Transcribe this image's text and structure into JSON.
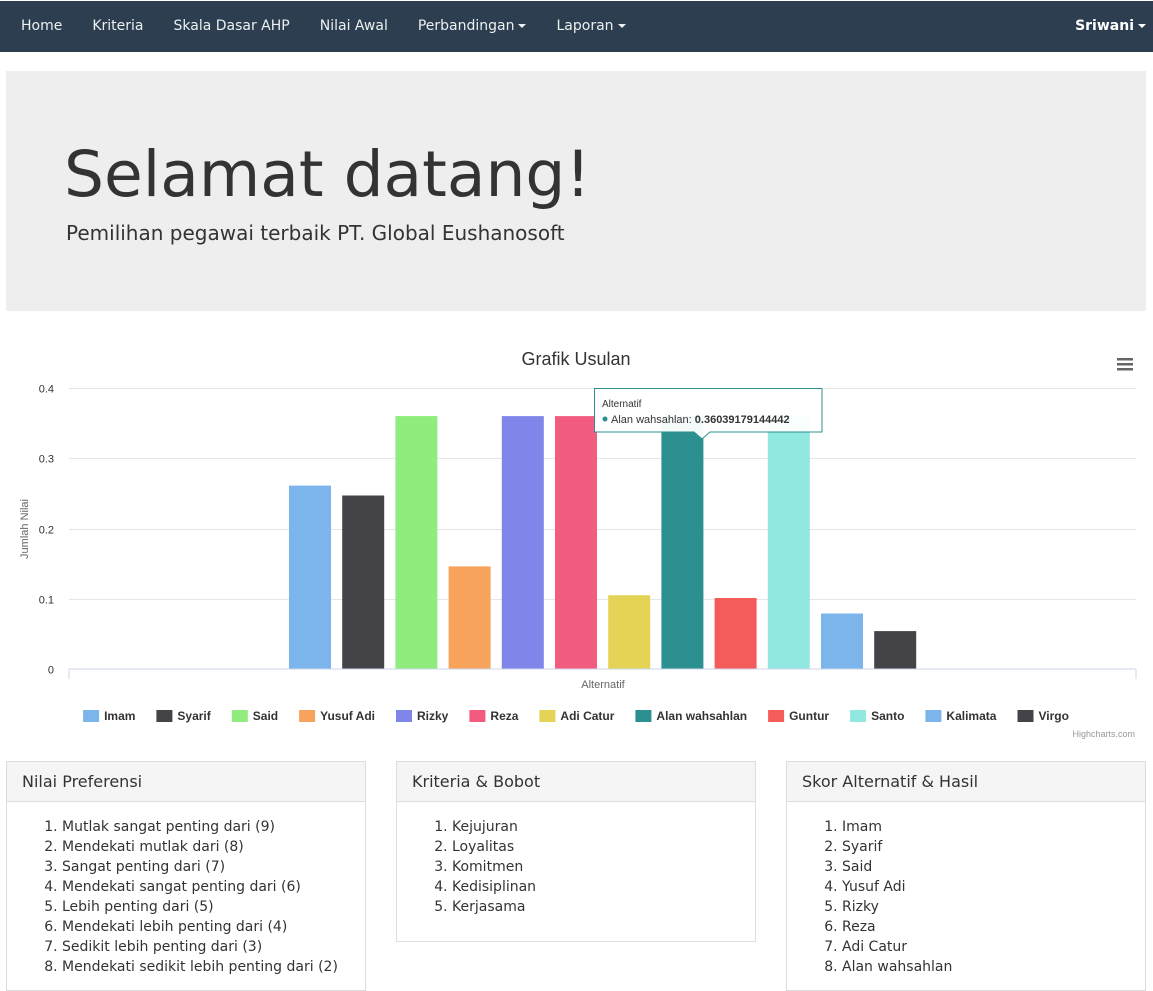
{
  "navbar": {
    "items": [
      {
        "label": "Home",
        "dropdown": false
      },
      {
        "label": "Kriteria",
        "dropdown": false
      },
      {
        "label": "Skala Dasar AHP",
        "dropdown": false
      },
      {
        "label": "Nilai Awal",
        "dropdown": false
      },
      {
        "label": "Perbandingan",
        "dropdown": true
      },
      {
        "label": "Laporan",
        "dropdown": true
      }
    ],
    "user": "Sriwani"
  },
  "jumbotron": {
    "title": "Selamat datang!",
    "subtitle": "Pemilihan pegawai terbaik PT. Global Eushanosoft"
  },
  "chart_data": {
    "type": "bar",
    "title": "Grafik Usulan",
    "xlabel": "Alternatif",
    "ylabel": "Jumlah Nilai",
    "ylim": [
      0,
      0.4
    ],
    "yticks": [
      "0",
      "0.1",
      "0.2",
      "0.3",
      "0.4"
    ],
    "grid": true,
    "legend_position": "bottom",
    "series": [
      {
        "name": "Imam",
        "value": 0.261,
        "color": "#7cb5ec"
      },
      {
        "name": "Syarif",
        "value": 0.247,
        "color": "#434348"
      },
      {
        "name": "Said",
        "value": 0.36,
        "color": "#90ed7d"
      },
      {
        "name": "Yusuf Adi",
        "value": 0.146,
        "color": "#f7a35c"
      },
      {
        "name": "Rizky",
        "value": 0.36,
        "color": "#8085e9"
      },
      {
        "name": "Reza",
        "value": 0.36,
        "color": "#f15c80"
      },
      {
        "name": "Adi Catur",
        "value": 0.105,
        "color": "#e4d354"
      },
      {
        "name": "Alan wahsahlan",
        "value": 0.36039179144442,
        "color": "#2b908f"
      },
      {
        "name": "Guntur",
        "value": 0.101,
        "color": "#f45b5b"
      },
      {
        "name": "Santo",
        "value": 0.36,
        "color": "#91e8e1"
      },
      {
        "name": "Kalimata",
        "value": 0.079,
        "color": "#7cb5ec"
      },
      {
        "name": "Virgo",
        "value": 0.054,
        "color": "#434348"
      }
    ],
    "tooltip": {
      "header": "Alternatif",
      "series": "Alan wahsahlan",
      "label": "Alan wahsahlan: ",
      "value": "0.36039179144442"
    },
    "credits": "Highcharts.com"
  },
  "panels": {
    "preferensi": {
      "title": "Nilai Preferensi",
      "items": [
        "Mutlak sangat penting dari (9)",
        "Mendekati mutlak dari (8)",
        "Sangat penting dari (7)",
        "Mendekati sangat penting dari (6)",
        "Lebih penting dari (5)",
        "Mendekati lebih penting dari (4)",
        "Sedikit lebih penting dari (3)",
        "Mendekati sedikit lebih penting dari (2)"
      ]
    },
    "kriteria": {
      "title": "Kriteria & Bobot",
      "items": [
        "Kejujuran",
        "Loyalitas",
        "Komitmen",
        "Kedisiplinan",
        "Kerjasama"
      ]
    },
    "skor": {
      "title": "Skor Alternatif & Hasil",
      "items": [
        "Imam",
        "Syarif",
        "Said",
        "Yusuf Adi",
        "Rizky",
        "Reza",
        "Adi Catur",
        "Alan wahsahlan"
      ]
    }
  }
}
